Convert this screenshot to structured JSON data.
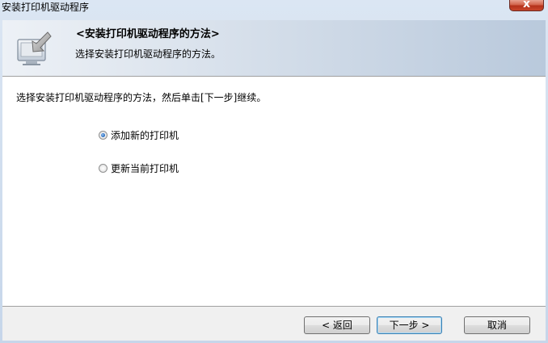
{
  "window": {
    "title": "安装打印机驱动程序",
    "close_label": "x"
  },
  "header": {
    "icon": "printer-install-icon",
    "title": "<安装打印机驱动程序的方法>",
    "subtitle": "选择安装打印机驱动程序的方法。"
  },
  "main": {
    "instruction": "选择安装打印机驱动程序的方法，然后单击[下一步]继续。",
    "options": [
      {
        "label": "添加新的打印机",
        "checked": true
      },
      {
        "label": "更新当前打印机",
        "checked": false
      }
    ]
  },
  "footer": {
    "back_label": "< 返回",
    "next_label": "下一步 >",
    "cancel_label": "取消"
  },
  "colors": {
    "window_frame": "#c6d6ea",
    "header_gradient_start": "#edf1f6",
    "header_gradient_end": "#b9c9dc",
    "close_button": "#c8462c",
    "radio_checked": "#2a6fc4",
    "default_button_border": "#3c7fb1"
  }
}
